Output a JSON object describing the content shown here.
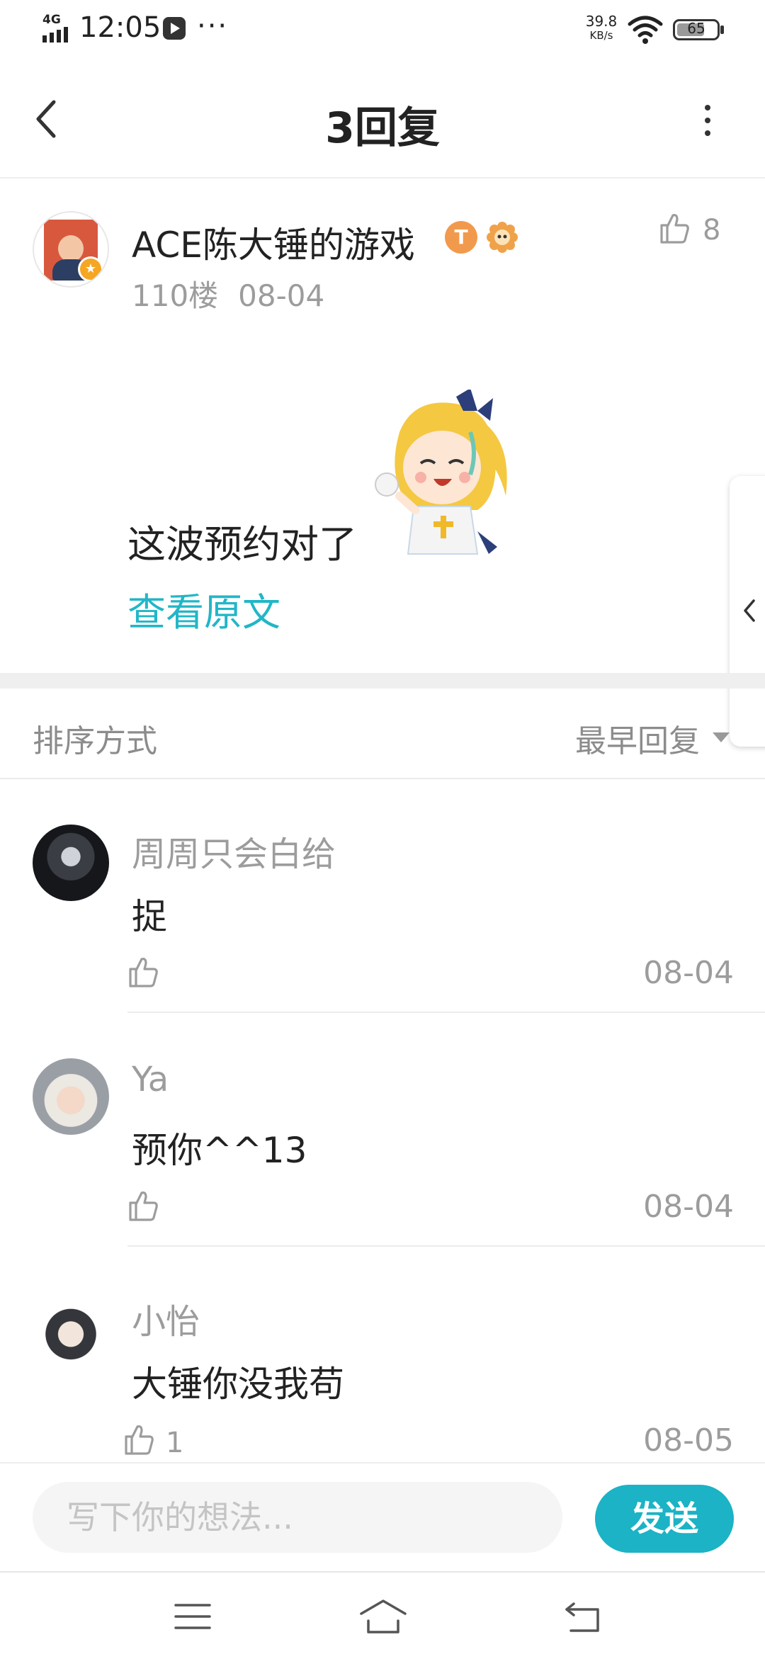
{
  "status_bar": {
    "network": "4G",
    "time": "12:05",
    "more": "···",
    "speed_value": "39.8",
    "speed_unit": "KB/s",
    "battery_level": "65"
  },
  "nav": {
    "title": "3回复"
  },
  "post": {
    "author": "ACE陈大锤的游戏",
    "badge_letter": "T",
    "floor": "110楼",
    "date": "08-04",
    "likes": "8",
    "text": "这波预约对了",
    "view_original": "查看原文"
  },
  "sort": {
    "label": "排序方式",
    "value": "最早回复"
  },
  "replies": [
    {
      "user": "周周只会白给",
      "content": "捉",
      "likes": "",
      "date": "08-04"
    },
    {
      "user": "Ya",
      "content": "预你^^13",
      "likes": "",
      "date": "08-04"
    },
    {
      "user": "小怡",
      "content": "大锤你没我苟",
      "likes": "1",
      "date": "08-05"
    }
  ],
  "composer": {
    "placeholder": "写下你的想法...",
    "send_label": "发送"
  },
  "colors": {
    "accent": "#1bb3c5",
    "link": "#22b6c7",
    "muted_text": "#9c9c9c"
  }
}
